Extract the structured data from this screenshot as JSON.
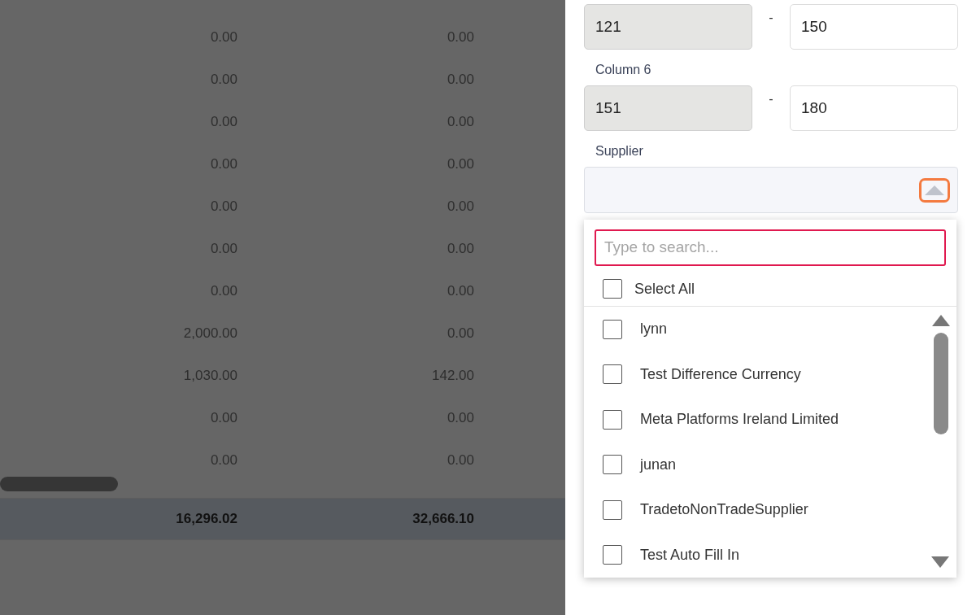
{
  "table": {
    "rows": [
      {
        "column_1": "0.00",
        "column_2": "0.00"
      },
      {
        "column_1": "0.00",
        "column_2": "0.00"
      },
      {
        "column_1": "0.00",
        "column_2": "0.00"
      },
      {
        "column_1": "0.00",
        "column_2": "0.00"
      },
      {
        "column_1": "0.00",
        "column_2": "0.00"
      },
      {
        "column_1": "0.00",
        "column_2": "0.00"
      },
      {
        "column_1": "0.00",
        "column_2": "0.00"
      },
      {
        "column_1": "2,000.00",
        "column_2": "0.00"
      },
      {
        "column_1": "1,030.00",
        "column_2": "142.00"
      },
      {
        "column_1": "0.00",
        "column_2": "0.00"
      },
      {
        "column_1": "0.00",
        "column_2": "0.00"
      }
    ],
    "totals": {
      "column_1": "16,296.02",
      "column_2": "32,666.10"
    }
  },
  "filters": {
    "ranges": [
      {
        "from": "121",
        "separator": "-",
        "to": "150"
      },
      {
        "label": "Column 6",
        "from": "151",
        "separator": "-",
        "to": "180"
      }
    ],
    "supplier": {
      "label": "Supplier",
      "expanded": true,
      "search": {
        "placeholder": "Type to search..."
      },
      "select_all": {
        "label": "Select All",
        "checked": false
      },
      "options": [
        {
          "label": "lynn",
          "checked": false
        },
        {
          "label": "Test Difference Currency",
          "checked": false
        },
        {
          "label": "Meta Platforms Ireland Limited",
          "checked": false
        },
        {
          "label": "junan",
          "checked": false
        },
        {
          "label": "TradetoNonTradeSupplier",
          "checked": false
        },
        {
          "label": "Test Auto Fill In",
          "checked": false
        }
      ]
    }
  }
}
